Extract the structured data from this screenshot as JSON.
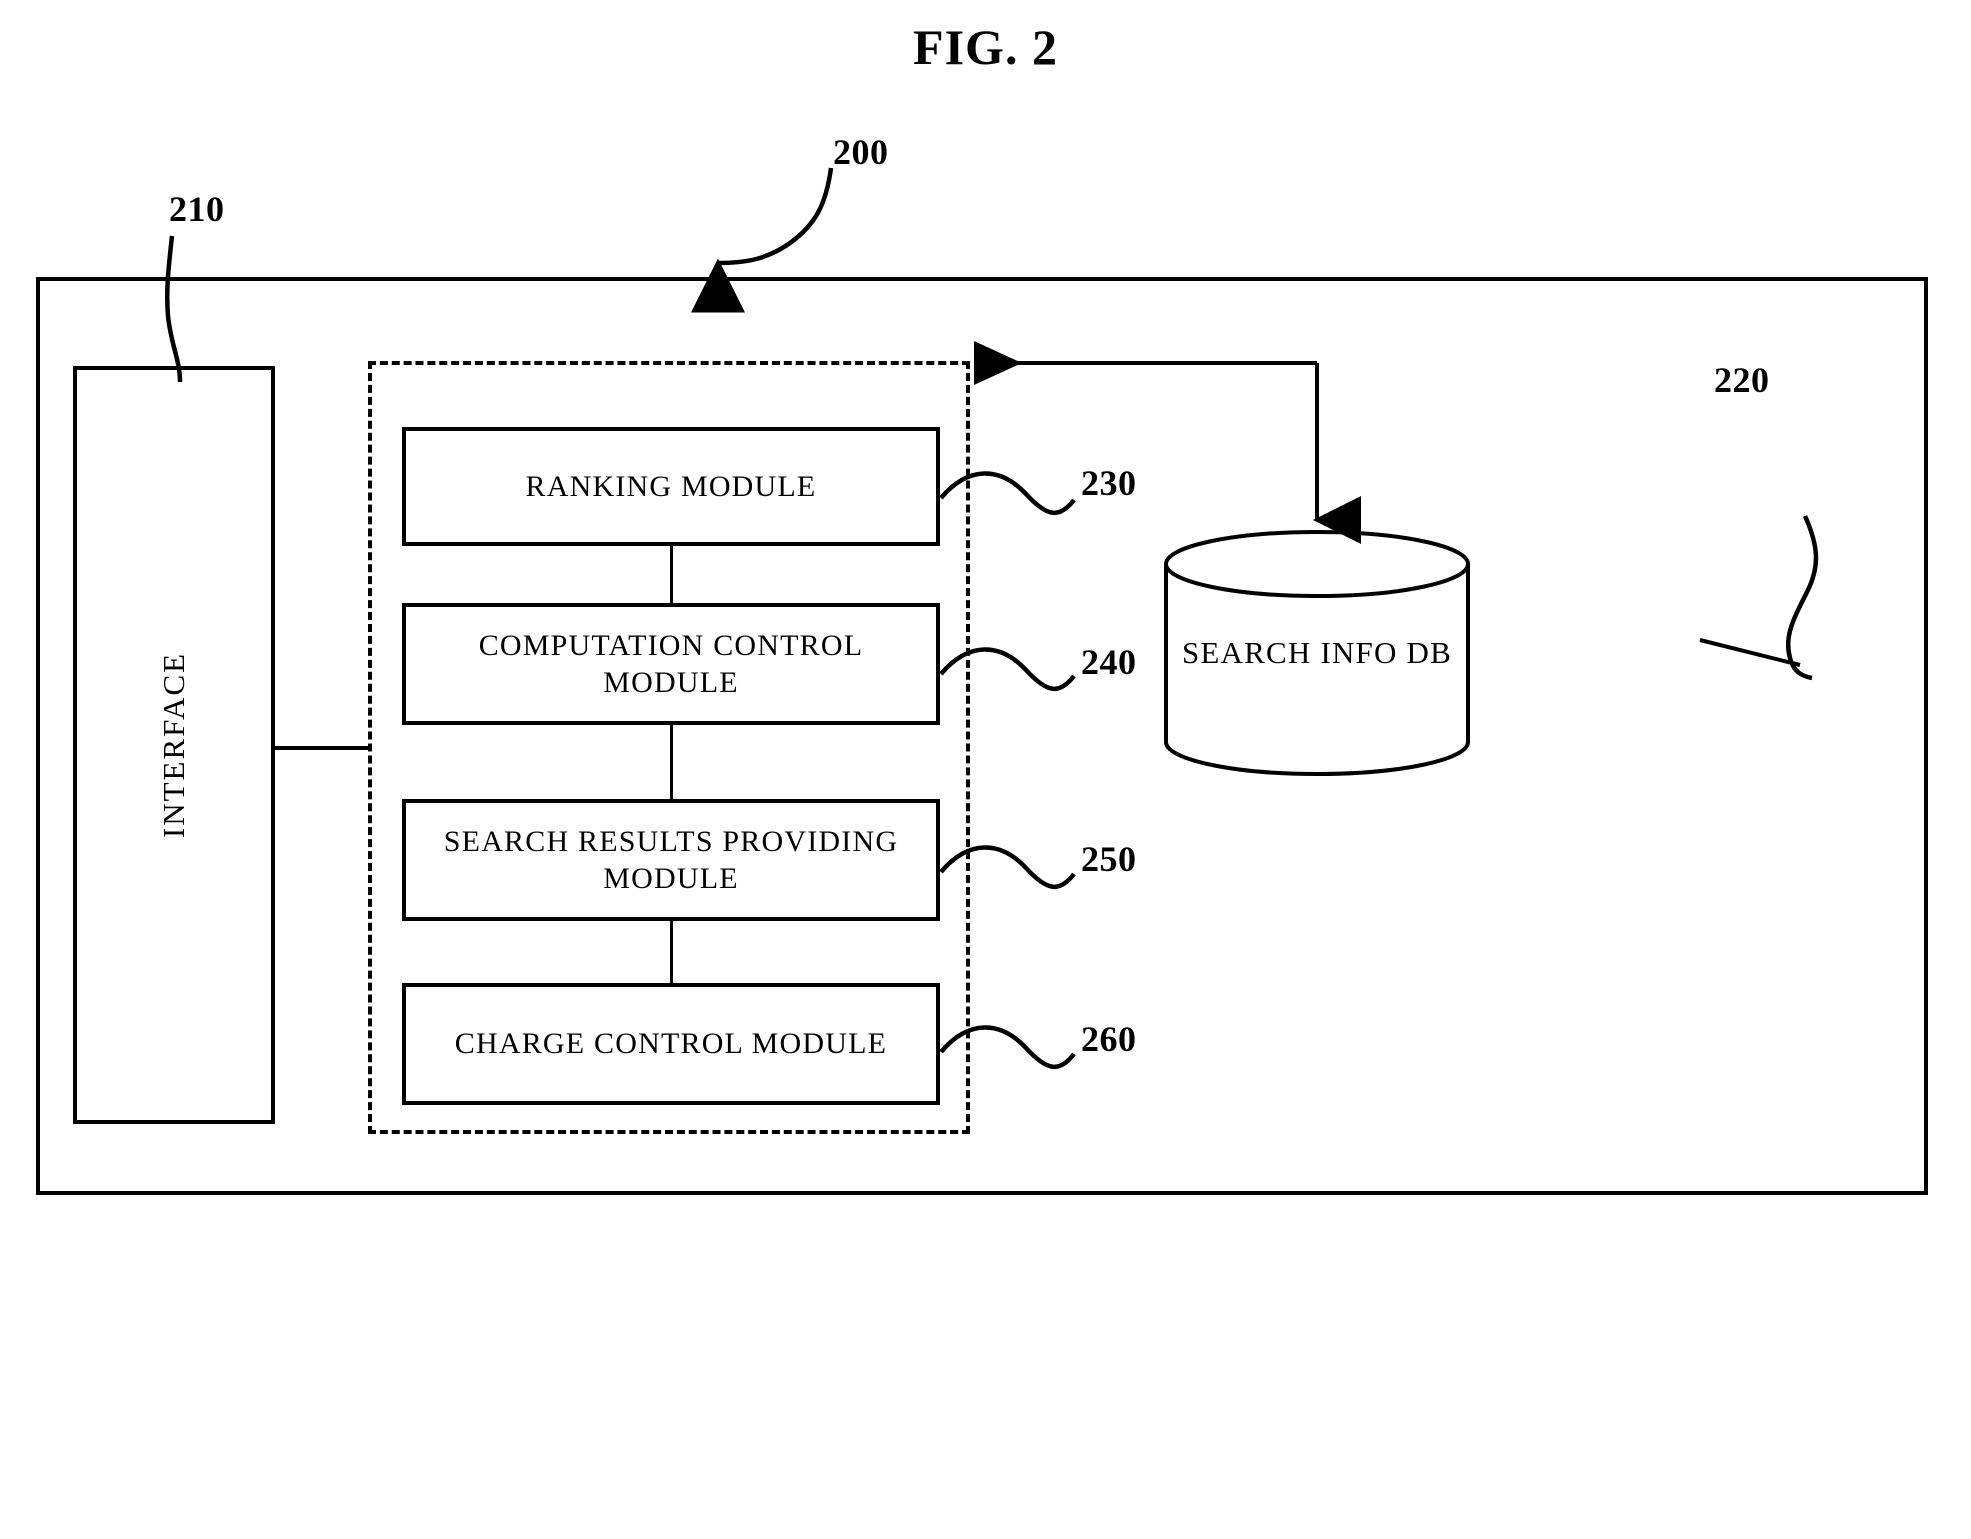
{
  "figure": {
    "title": "FIG. 2",
    "kind": "patent-block-diagram"
  },
  "blocks": {
    "system": {
      "label": "",
      "ref": "200"
    },
    "interface": {
      "label": "INTERFACE",
      "ref": "210"
    },
    "database": {
      "label": "SEARCH INFO DB",
      "ref": "220",
      "shape": "cylinder"
    },
    "modules": [
      {
        "label": "RANKING MODULE",
        "ref": "230"
      },
      {
        "label": "COMPUTATION CONTROL MODULE",
        "ref": "240"
      },
      {
        "label": "SEARCH RESULTS PROVIDING MODULE",
        "ref": "250"
      },
      {
        "label": "CHARGE CONTROL MODULE",
        "ref": "260"
      }
    ]
  },
  "refs": {
    "r200": "200",
    "r210": "210",
    "r220": "220",
    "r230": "230",
    "r240": "240",
    "r250": "250",
    "r260": "260"
  },
  "connections": [
    {
      "from": "interface",
      "to": "module-group",
      "style": "solid-line"
    },
    {
      "from": "RANKING MODULE",
      "to": "COMPUTATION CONTROL MODULE",
      "style": "solid-line"
    },
    {
      "from": "COMPUTATION CONTROL MODULE",
      "to": "SEARCH RESULTS PROVIDING MODULE",
      "style": "solid-line"
    },
    {
      "from": "SEARCH RESULTS PROVIDING MODULE",
      "to": "CHARGE CONTROL MODULE",
      "style": "solid-line"
    },
    {
      "from": "SEARCH INFO DB",
      "to": "module-group",
      "style": "arrow-left"
    }
  ],
  "colors": {
    "ink": "#000000",
    "paper": "#ffffff"
  },
  "icons": {
    "leader_curve": "leader-curve-icon",
    "arrow_head": "arrow-head-icon",
    "cylinder": "database-cylinder-icon"
  }
}
